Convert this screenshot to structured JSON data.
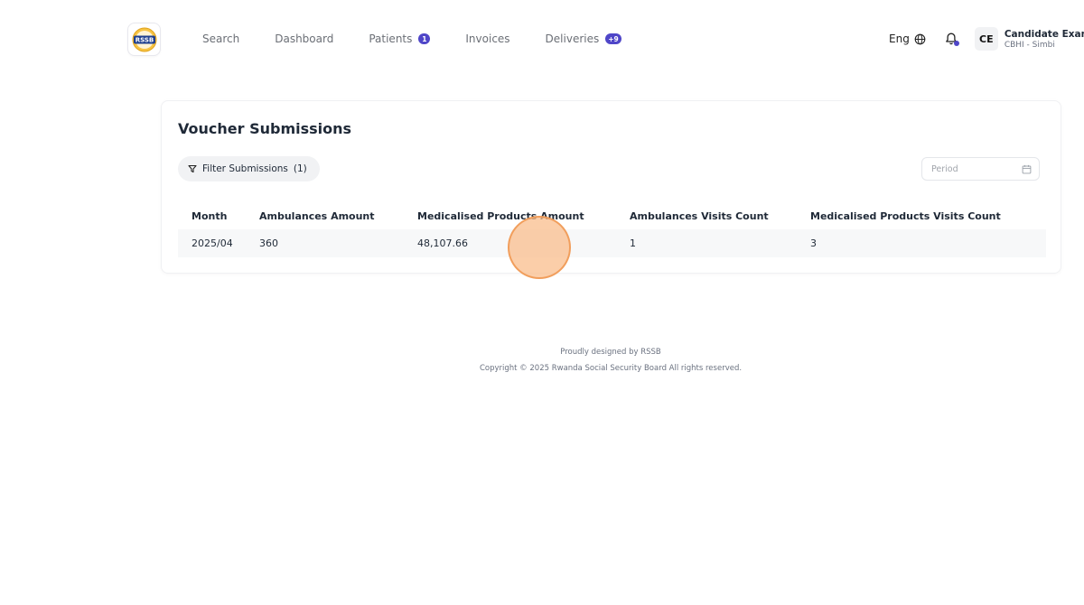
{
  "header": {
    "logo_text": "RSSB",
    "nav": [
      {
        "label": "Search"
      },
      {
        "label": "Dashboard"
      },
      {
        "label": "Patients",
        "badge": "1"
      },
      {
        "label": "Invoices"
      },
      {
        "label": "Deliveries",
        "badge": "+9"
      }
    ],
    "language": "Eng",
    "user": {
      "initials": "CE",
      "name": "Candidate Exam",
      "org": "CBHI - Simbi"
    }
  },
  "page": {
    "title": "Voucher Submissions",
    "filter_label": "Filter Submissions",
    "filter_count": "(1)",
    "period_placeholder": "Period"
  },
  "table": {
    "columns": [
      "Month",
      "Ambulances Amount",
      "Medicalised Products Amount",
      "Ambulances Visits Count",
      "Medicalised Products Visits Count"
    ],
    "rows": [
      [
        "2025/04",
        "360",
        "48,107.66",
        "1",
        "3"
      ]
    ]
  },
  "footer": {
    "line1": "Proudly designed by RSSB",
    "line2": "Copyright © 2025 Rwanda Social Security Board All rights reserved."
  },
  "colors": {
    "accent": "#4f46c8",
    "click_indicator": "#f5a86a"
  }
}
